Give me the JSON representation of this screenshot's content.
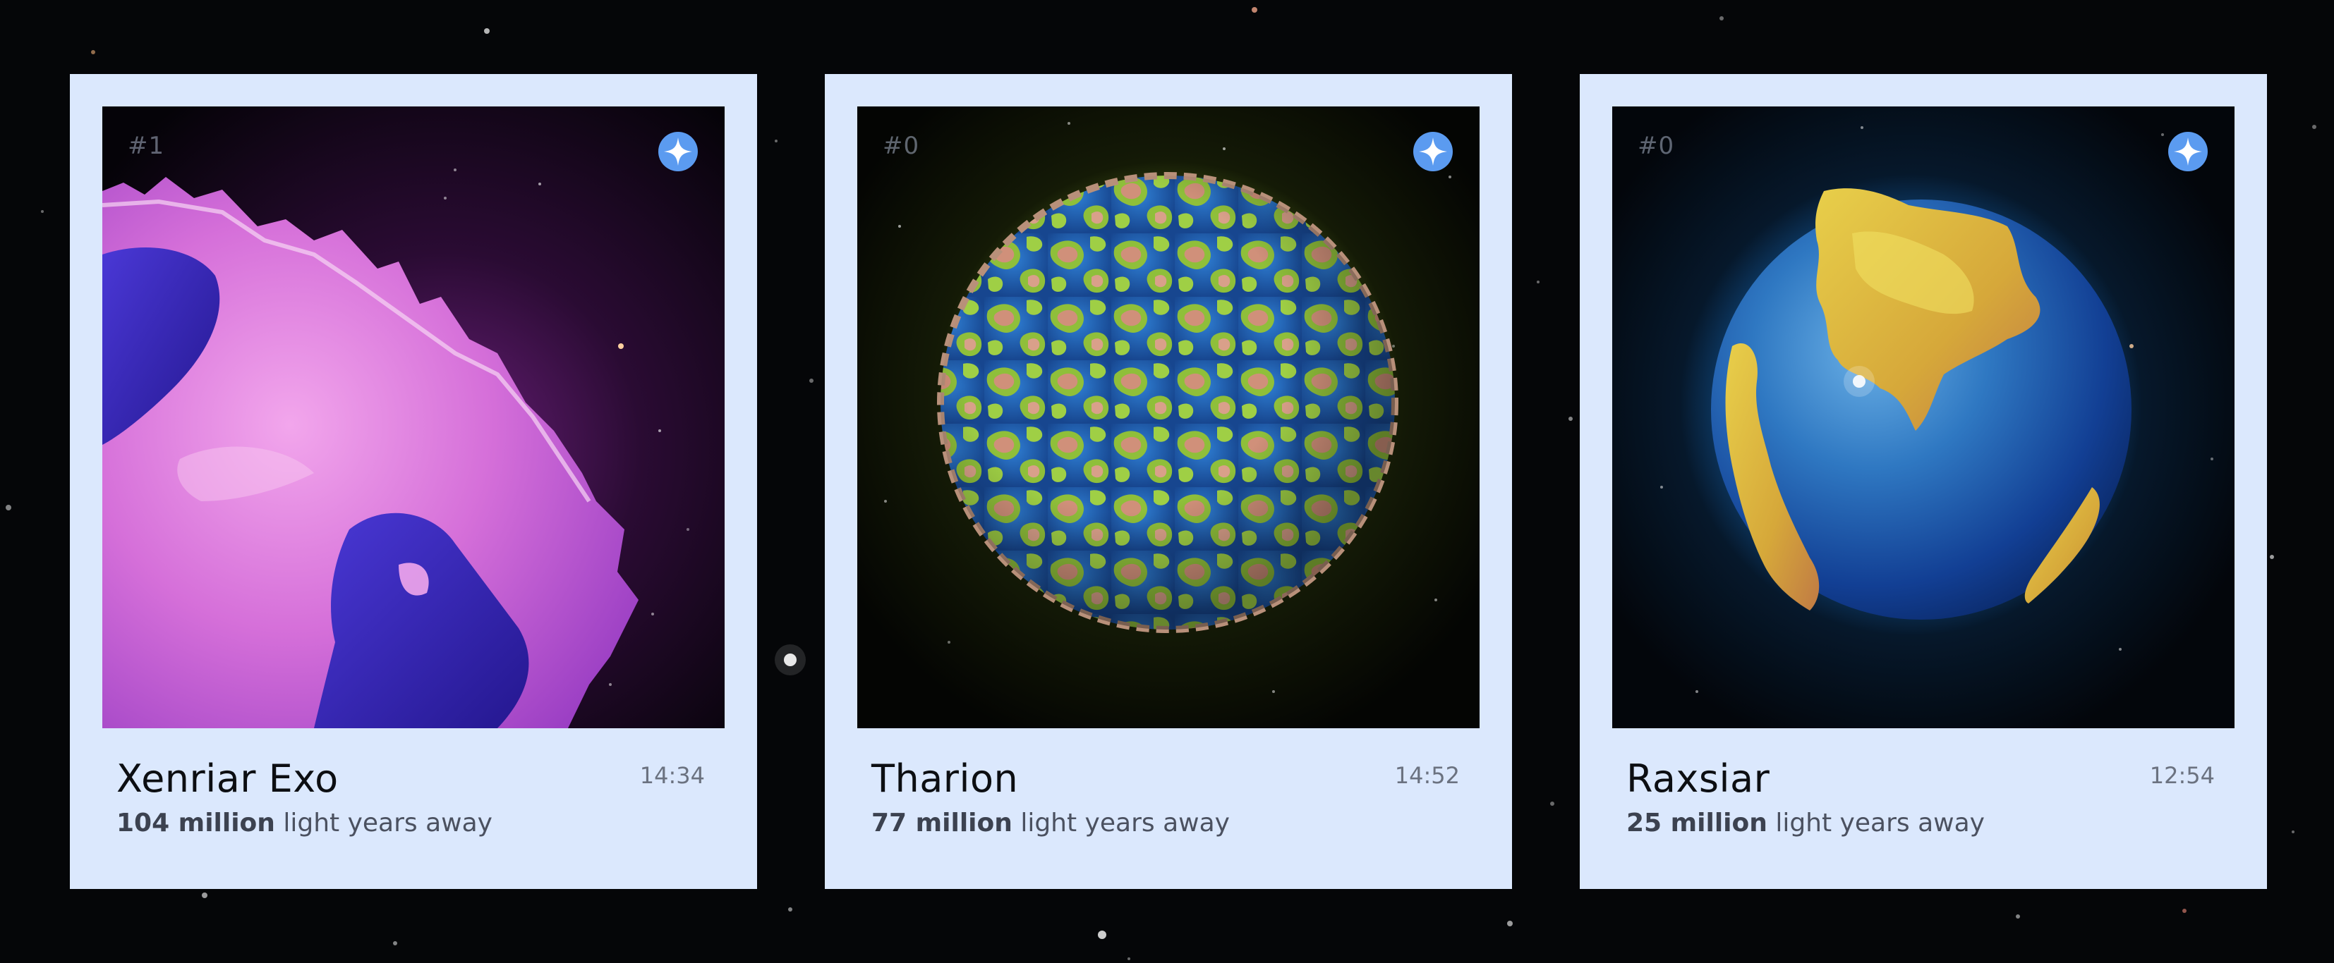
{
  "planets": [
    {
      "index": "#1",
      "name": "Xenriar Exo",
      "time": "14:34",
      "distance_value": "104 million",
      "distance_suffix": "light years away",
      "palette": {
        "land": "#d97fe0",
        "ocean": "#3b2bb8",
        "glow": "#b13bd6"
      }
    },
    {
      "index": "#0",
      "name": "Tharion",
      "time": "14:52",
      "distance_value": "77 million",
      "distance_suffix": "light years away",
      "palette": {
        "land": "#8fbf3a",
        "ocean": "#1f5fb8",
        "glow": "#8fa02a"
      }
    },
    {
      "index": "#0",
      "name": "Raxsiar",
      "time": "12:54",
      "distance_value": "25 million",
      "distance_suffix": "light years away",
      "palette": {
        "land": "#d9b43a",
        "ocean": "#1d5ea8",
        "glow": "#1d6fb0"
      }
    }
  ],
  "icons": {
    "favorite": "sparkle-star-icon"
  },
  "colors": {
    "card_bg": "#dbe8fd",
    "accent": "#5b9bf0",
    "page_bg": "#050608"
  }
}
